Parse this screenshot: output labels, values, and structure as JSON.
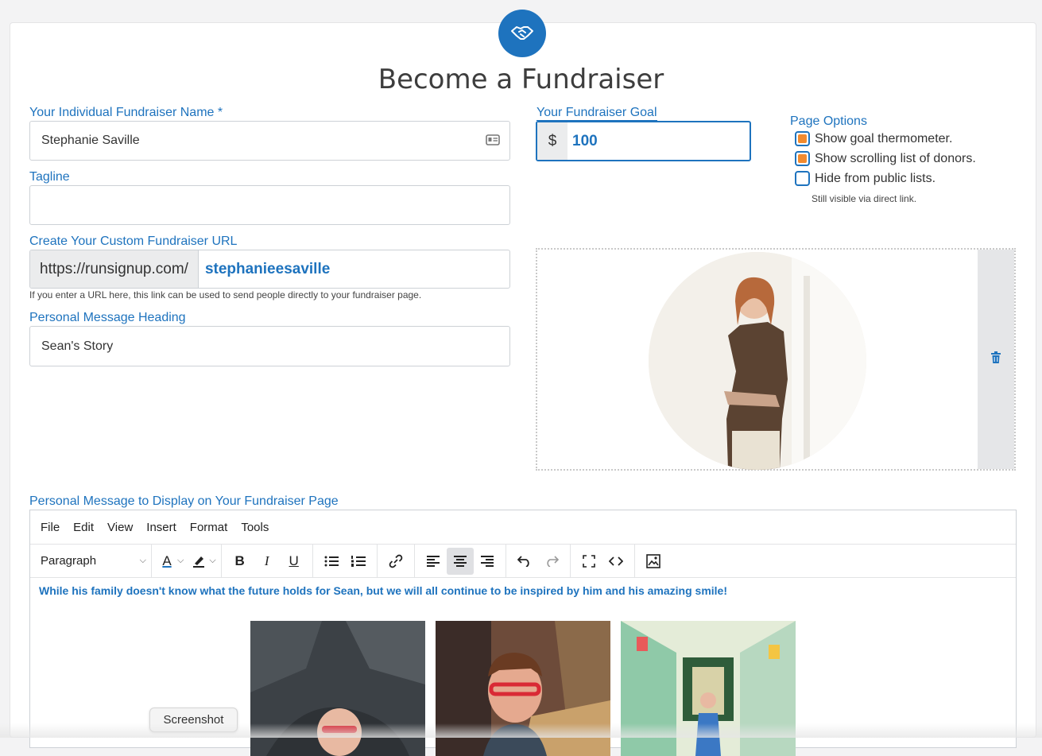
{
  "header": {
    "title": "Become a Fundraiser",
    "logo_icon": "handshake-icon",
    "brand_color": "#1e73be"
  },
  "form": {
    "name_label": "Your Individual Fundraiser Name *",
    "name_value": "Stephanie Saville",
    "tagline_label": "Tagline",
    "tagline_value": "",
    "url_label": "Create Your Custom Fundraiser URL",
    "url_prefix": "https://runsignup.com/",
    "url_slug": "stephanieesaville",
    "url_help": "If you enter a URL here, this link can be used to send people directly to your fundraiser page.",
    "heading_label": "Personal Message Heading",
    "heading_value": "Sean's Story",
    "goal_label": "Your Fundraiser Goal",
    "goal_currency": "$",
    "goal_value": "100"
  },
  "page_options": {
    "label": "Page Options",
    "options": [
      {
        "label": "Show goal thermometer.",
        "checked": true
      },
      {
        "label": "Show scrolling list of donors.",
        "checked": true
      },
      {
        "label": "Hide from public lists.",
        "checked": false
      }
    ],
    "hint": "Still visible via direct link."
  },
  "photo": {
    "delete_icon": "trash-icon"
  },
  "editor": {
    "label": "Personal Message to Display on Your Fundraiser Page",
    "menu": [
      "File",
      "Edit",
      "View",
      "Insert",
      "Format",
      "Tools"
    ],
    "block_format": "Paragraph",
    "message": "While his family doesn't know what the future holds for Sean, but we will all continue to be inspired by him and his amazing smile!"
  },
  "tooltip": "Screenshot"
}
